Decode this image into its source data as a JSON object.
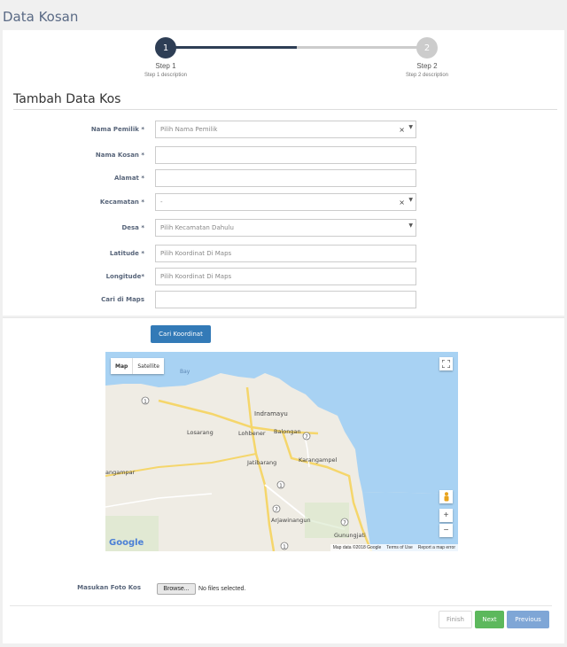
{
  "page": {
    "title": "Data Kosan"
  },
  "stepper": {
    "steps": [
      {
        "number": "1",
        "label": "Step 1",
        "description": "Step 1 description"
      },
      {
        "number": "2",
        "label": "Step 2",
        "description": "Step 2 description"
      }
    ],
    "progress": 0.5,
    "colors": {
      "active": "#2e3e55",
      "inactive": "#cccccc"
    }
  },
  "form": {
    "title": "Tambah Data Kos",
    "fields": [
      {
        "label": "Nama Pemilik *",
        "value": "Pilih Nama Pemilik",
        "type": "select-clear"
      },
      {
        "label": "Nama Kosan *",
        "value": "",
        "type": "text"
      },
      {
        "label": "Alamat *",
        "value": "",
        "type": "text"
      },
      {
        "label": "Kecamatan *",
        "value": "-",
        "type": "select-clear"
      },
      {
        "label": "Desa *",
        "value": "Pilih Kecamatan Dahulu",
        "type": "select"
      },
      {
        "label": "Latitude *",
        "value": "Pilih Koordinat Di Maps",
        "type": "text"
      },
      {
        "label": "Longitude*",
        "value": "Pilih Koordinat Di Maps",
        "type": "text"
      },
      {
        "label": "Cari di Maps",
        "value": "",
        "type": "text"
      }
    ],
    "clear_symbol": "×",
    "dropdown_symbol": "▼"
  },
  "map": {
    "search_button": "Cari Koordinat",
    "type_map": "Map",
    "type_satellite": "Satellite",
    "logo": "Google",
    "places": [
      "Indramayu",
      "Losarang",
      "Lohbener",
      "Balongan",
      "Jatibarang",
      "Karangampel",
      "angampar",
      "Arjawinangun",
      "Gunungjati",
      "Bay"
    ],
    "road_numbers": [
      "1",
      "7",
      "1",
      "7",
      "1",
      "7"
    ],
    "footer": {
      "data": "Map data ©2018 Google",
      "terms": "Terms of Use",
      "report": "Report a map error"
    },
    "zoom_in": "+",
    "zoom_out": "−",
    "colors": {
      "land": "#efece4",
      "water": "#a8d2f3",
      "road": "#f5d66b"
    }
  },
  "upload": {
    "label": "Masukan Foto Kos",
    "browse": "Browse...",
    "status": "No files selected."
  },
  "wizard": {
    "finish": "Finish",
    "next": "Next",
    "previous": "Previous",
    "colors": {
      "next": "#5cb85c",
      "previous": "#7fa6d6"
    }
  }
}
